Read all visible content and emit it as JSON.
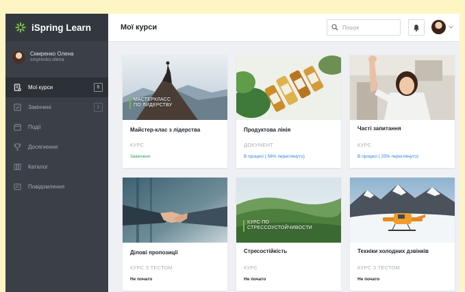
{
  "app": {
    "brand": "iSpring Learn"
  },
  "user": {
    "name": "Смиренко Олена",
    "login": "smyrenko.olena"
  },
  "sidebar": {
    "items": [
      {
        "label": "Мої курси",
        "badge": "6",
        "icon": "courses-icon",
        "active": true
      },
      {
        "label": "Закінчені",
        "badge": "1",
        "icon": "completed-check-icon",
        "active": false
      },
      {
        "label": "Події",
        "badge": "",
        "icon": "calendar-icon",
        "active": false
      },
      {
        "label": "Досягнення",
        "badge": "",
        "icon": "trophy-icon",
        "active": false
      },
      {
        "label": "Каталог",
        "badge": "",
        "icon": "catalog-icon",
        "active": false
      },
      {
        "label": "Повідомлення",
        "badge": "",
        "icon": "messages-icon",
        "active": false
      }
    ]
  },
  "header": {
    "title": "Мої курси",
    "search_placeholder": "Пошук"
  },
  "cards": [
    {
      "title": "Майстер-клас з лідерства",
      "type": "КУРС",
      "status": "Закінчено",
      "image_caption": "МАСТЕРКЛАСС\nПО ЛИДЕРСТВУ"
    },
    {
      "title": "Продуктова лінія",
      "type": "ДОКУМЕНТ",
      "status": "В процесі ( 56% переглянуто)",
      "progress": 56
    },
    {
      "title": "Часті запитання",
      "type": "КУРС",
      "status": "В процесі ( 25% переглянуто)",
      "progress": 25
    },
    {
      "title": "Ділові пропозиції",
      "type": "КУРС З ТЕСТОМ",
      "status": "Не почато"
    },
    {
      "title": "Стресостійкість",
      "type": "КУРС",
      "status": "Не почато",
      "image_caption": "КУРС ПО\nСТРЕССОУСТОЙЧИВОСТИ"
    },
    {
      "title": "Техніки холодних дзвінків",
      "type": "КУРС З ТЕСТОМ",
      "status": "Не почато"
    }
  ],
  "colors": {
    "sidebar_bg": "#3b4048",
    "accent_green": "#6fc04b",
    "status_completed": "#2e9f47",
    "status_in_progress": "#2b7fd8"
  }
}
